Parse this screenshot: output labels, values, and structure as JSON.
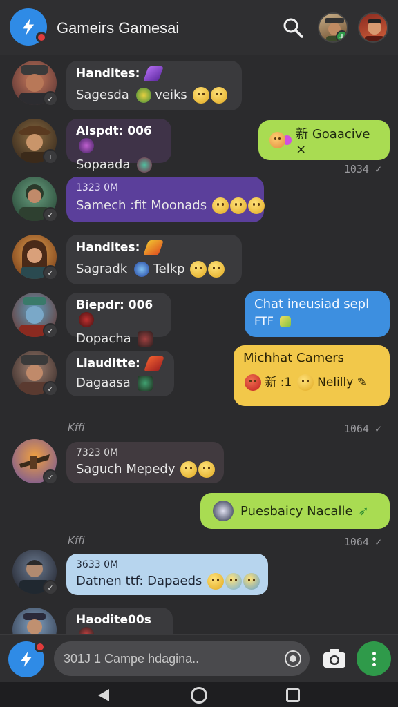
{
  "header": {
    "title": "Gameirs Gamesai"
  },
  "messages": [
    {
      "sender": "Handites:",
      "text": "Sagesda",
      "text2": "veiks"
    },
    {
      "sender": "Alspdt: 006",
      "text": "Sopaada"
    },
    {
      "time": "1323 0M",
      "text": "Samech :fit Moonads"
    },
    {
      "sender": "Handites:",
      "text": "Sagradk",
      "text2": "Telkp"
    },
    {
      "sender": "Biepdr: 006",
      "text": "Dopacha"
    },
    {
      "sender": "Llauditte:",
      "text": "Dagaasa"
    },
    {
      "time": "7323 0M",
      "text": "Saguch Mepedy"
    },
    {
      "time": "3633 0M",
      "text": "Datnen ttf: Dapaeds"
    },
    {
      "sender": "Haodite00s"
    }
  ],
  "outgoing": [
    {
      "text": "新 Goaacive ×",
      "meta": "1034"
    },
    {
      "text": "Chat ineusiad sepl",
      "text2": "FTF",
      "meta": "11134"
    },
    {
      "text": "Michhat Camers",
      "text2": "新 :1",
      "text3": "Nelilly",
      "meta": "1064"
    },
    {
      "text": "Puesbaicy Nacalle",
      "meta": "1064"
    }
  ],
  "day_labels": [
    "Kffi",
    "Kffi"
  ],
  "composer": {
    "placeholder": "301J 1 Campe hdagina.."
  },
  "colors": {
    "accent_blue": "#2f8be6",
    "bubble_green": "#a9dc52",
    "bubble_blue": "#3d8fe0",
    "bubble_yellow": "#f2c84a",
    "bubble_purple": "#5b3f9b",
    "notification_red": "#e23b3b",
    "fab_green": "#2f9a4a"
  },
  "icons": [
    "lightning-bolt-icon",
    "search-icon",
    "camera-icon",
    "more-vertical-icon",
    "attach-icon",
    "nav-back-icon",
    "nav-home-icon",
    "nav-recent-icon"
  ]
}
